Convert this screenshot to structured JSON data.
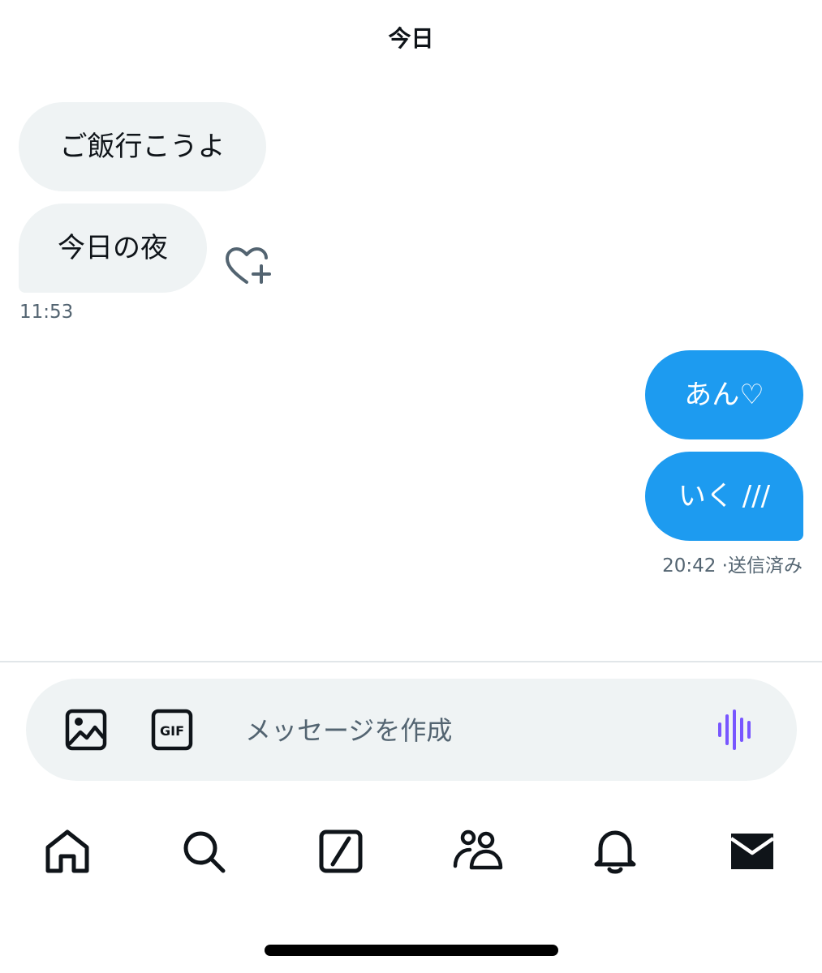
{
  "header": {
    "date_label": "今日"
  },
  "messages": {
    "received": [
      {
        "text": "ご飯行こうよ"
      },
      {
        "text": "今日の夜"
      }
    ],
    "received_time": "11:53",
    "sent": [
      {
        "text": "あん♡"
      },
      {
        "text": "いく ///"
      }
    ],
    "sent_status": "20:42 ·送信済み"
  },
  "composer": {
    "placeholder": "メッセージを作成",
    "gif_label": "GIF"
  },
  "tabs": [
    "home-icon",
    "search-icon",
    "grok-icon",
    "communities-icon",
    "notifications-icon",
    "messages-icon"
  ],
  "colors": {
    "sent_bubble": "#1d9bf0",
    "received_bubble": "#eff3f4",
    "voice_accent": "#7856ff",
    "secondary_text": "#536471"
  }
}
